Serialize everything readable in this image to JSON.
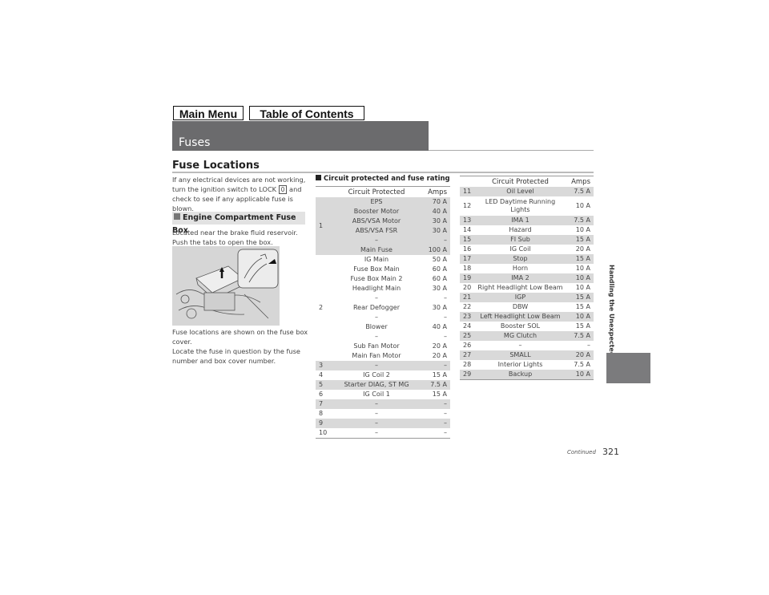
{
  "nav": {
    "main_menu": "Main Menu",
    "toc": "Table of Contents"
  },
  "header": {
    "title": "Fuses"
  },
  "section": {
    "title": "Fuse Locations"
  },
  "left": {
    "intro_1": "If any electrical devices are not working, turn the ignition switch to LOCK",
    "lock_symbol": "0",
    "intro_2": "and check to see if any applicable fuse is blown.",
    "subhead": "Engine Compartment Fuse Box",
    "located": "Located near the brake fluid reservoir. Push the tabs to open the box.",
    "image_alt": "engine-compartment-fuse-box-illustration",
    "shown": "Fuse locations are shown on the fuse box cover.",
    "locate": "Locate the fuse in question by the fuse number and box cover number."
  },
  "table_title": "Circuit protected and fuse rating",
  "table_headers": {
    "circuit": "Circuit Protected",
    "amps": "Amps"
  },
  "group1": {
    "num": "1",
    "rows": [
      {
        "circuit": "EPS",
        "amps": "70 A"
      },
      {
        "circuit": "Booster Motor",
        "amps": "40 A"
      },
      {
        "circuit": "ABS/VSA Motor",
        "amps": "30 A"
      },
      {
        "circuit": "ABS/VSA FSR",
        "amps": "30 A"
      },
      {
        "circuit": "–",
        "amps": "–"
      },
      {
        "circuit": "Main Fuse",
        "amps": "100 A"
      }
    ]
  },
  "group2": {
    "num": "2",
    "rows": [
      {
        "circuit": "IG Main",
        "amps": "50 A"
      },
      {
        "circuit": "Fuse Box Main",
        "amps": "60 A"
      },
      {
        "circuit": "Fuse Box Main 2",
        "amps": "60 A"
      },
      {
        "circuit": "Headlight Main",
        "amps": "30 A"
      },
      {
        "circuit": "–",
        "amps": "–"
      },
      {
        "circuit": "Rear Defogger",
        "amps": "30 A"
      },
      {
        "circuit": "–",
        "amps": "–"
      },
      {
        "circuit": "Blower",
        "amps": "40 A"
      },
      {
        "circuit": "–",
        "amps": "–"
      },
      {
        "circuit": "Sub Fan Motor",
        "amps": "20 A"
      },
      {
        "circuit": "Main Fan Motor",
        "amps": "20 A"
      }
    ]
  },
  "left_rows": [
    {
      "num": "3",
      "circuit": "–",
      "amps": "–"
    },
    {
      "num": "4",
      "circuit": "IG Coil 2",
      "amps": "15 A"
    },
    {
      "num": "5",
      "circuit": "Starter DIAG, ST MG",
      "amps": "7.5 A"
    },
    {
      "num": "6",
      "circuit": "IG Coil 1",
      "amps": "15 A"
    },
    {
      "num": "7",
      "circuit": "–",
      "amps": "–"
    },
    {
      "num": "8",
      "circuit": "–",
      "amps": "–"
    },
    {
      "num": "9",
      "circuit": "–",
      "amps": "–"
    },
    {
      "num": "10",
      "circuit": "–",
      "amps": "–"
    }
  ],
  "right_rows": [
    {
      "num": "11",
      "circuit": "Oil Level",
      "amps": "7.5 A"
    },
    {
      "num": "12",
      "circuit": "LED Daytime Running Lights",
      "amps": "10 A"
    },
    {
      "num": "13",
      "circuit": "IMA 1",
      "amps": "7.5 A"
    },
    {
      "num": "14",
      "circuit": "Hazard",
      "amps": "10 A"
    },
    {
      "num": "15",
      "circuit": "FI Sub",
      "amps": "15 A"
    },
    {
      "num": "16",
      "circuit": "IG Coil",
      "amps": "20 A"
    },
    {
      "num": "17",
      "circuit": "Stop",
      "amps": "15 A"
    },
    {
      "num": "18",
      "circuit": "Horn",
      "amps": "10 A"
    },
    {
      "num": "19",
      "circuit": "IMA 2",
      "amps": "10 A"
    },
    {
      "num": "20",
      "circuit": "Right Headlight Low Beam",
      "amps": "10 A"
    },
    {
      "num": "21",
      "circuit": "IGP",
      "amps": "15 A"
    },
    {
      "num": "22",
      "circuit": "DBW",
      "amps": "15 A"
    },
    {
      "num": "23",
      "circuit": "Left Headlight Low Beam",
      "amps": "10 A"
    },
    {
      "num": "24",
      "circuit": "Booster SOL",
      "amps": "15 A"
    },
    {
      "num": "25",
      "circuit": "MG Clutch",
      "amps": "7.5 A"
    },
    {
      "num": "26",
      "circuit": "–",
      "amps": "–"
    },
    {
      "num": "27",
      "circuit": "SMALL",
      "amps": "20 A"
    },
    {
      "num": "28",
      "circuit": "Interior Lights",
      "amps": "7.5 A"
    },
    {
      "num": "29",
      "circuit": "Backup",
      "amps": "10 A"
    }
  ],
  "footer": {
    "continued": "Continued",
    "page": "321"
  },
  "side_tab": {
    "label": "Handling the Unexpected"
  }
}
